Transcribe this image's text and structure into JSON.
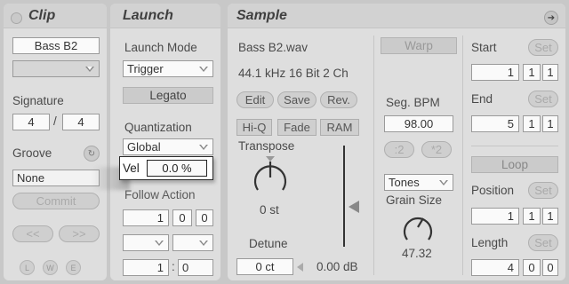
{
  "clip": {
    "title": "Clip",
    "name": "Bass B2",
    "signature_label": "Signature",
    "sig_num": "4",
    "sig_sep": "/",
    "sig_den": "4",
    "groove_label": "Groove",
    "groove_value": "None",
    "commit_label": "Commit",
    "prev_label": "<<",
    "next_label": ">>",
    "bottom_icons": [
      "L",
      "W",
      "E"
    ]
  },
  "launch": {
    "title": "Launch",
    "mode_label": "Launch Mode",
    "mode_value": "Trigger",
    "legato_label": "Legato",
    "quant_label": "Quantization",
    "quant_value": "Global",
    "vel_label": "Vel",
    "vel_value": "0.0 %",
    "follow_label": "Follow Action",
    "follow_vals": [
      "1",
      "0",
      "0"
    ],
    "chance_a": "1",
    "chance_sep": ":",
    "chance_b": "0"
  },
  "sample": {
    "title": "Sample",
    "filename": "Bass B2.wav",
    "format": "44.1 kHz 16 Bit 2 Ch",
    "edit": "Edit",
    "save": "Save",
    "rev": "Rev.",
    "hiq": "Hi-Q",
    "fade": "Fade",
    "ram": "RAM",
    "transpose_label": "Transpose",
    "transpose_value": "0 st",
    "detune_label": "Detune",
    "detune_value": "0 ct",
    "gain_value": "0.00 dB",
    "warp": "Warp",
    "segbpm_label": "Seg. BPM",
    "segbpm_value": "98.00",
    "half": ":2",
    "double": "*2",
    "warp_mode": "Tones",
    "grain_label": "Grain Size",
    "grain_value": "47.32",
    "start_label": "Start",
    "start_set": "Set",
    "start_vals": [
      "1",
      "1",
      "1"
    ],
    "end_label": "End",
    "end_set": "Set",
    "end_vals": [
      "5",
      "1",
      "1"
    ],
    "loop_label": "Loop",
    "position_label": "Position",
    "position_set": "Set",
    "position_vals": [
      "1",
      "1",
      "1"
    ],
    "length_label": "Length",
    "length_set": "Set",
    "length_vals": [
      "4",
      "0",
      "0"
    ]
  }
}
